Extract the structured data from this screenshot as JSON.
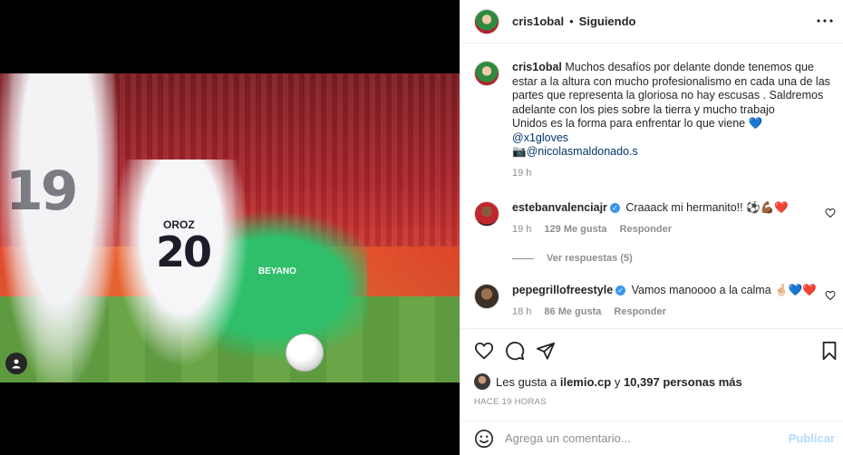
{
  "post": {
    "author": "cris1obal",
    "separator": "•",
    "follow_status": "Siguiendo",
    "caption_text": "Muchos desafíos por delante donde tenemos que estar a la altura con mucho profesionalismo en cada una de las partes que representa la gloriosa no hay escusas . Saldremos adelante con los pies sobre la tierra y mucho trabajo",
    "caption_line2": "Unidos es la forma para enfrentar lo que viene 💙",
    "mention1": "@x1gloves",
    "photo_credit_prefix": "📷",
    "mention2": "@nicolasmaldonado.s",
    "caption_time": "19 h"
  },
  "photo": {
    "shirt_name": "OROZ",
    "shirt_number": "20",
    "background_number": "19",
    "sponsor": "BEYANO"
  },
  "comments": [
    {
      "user": "estebanvalenciajr",
      "text": "Craaack mi hermanito!! ⚽💪🏾❤️",
      "time": "19 h",
      "likes": "129 Me gusta",
      "reply": "Responder",
      "view_replies": "Ver respuestas (5)"
    },
    {
      "user": "pepegrillofreestyle",
      "text": "Vamos manoooo a la calma 🤞🏻💙❤️",
      "time": "18 h",
      "likes": "86 Me gusta",
      "reply": "Responder"
    }
  ],
  "likes_summary": {
    "prefix": "Les gusta a",
    "user": "ilemio.cp",
    "connector": "y",
    "others": "10,397 personas más"
  },
  "timestamp": "HACE 19 HORAS",
  "comment_box": {
    "placeholder": "Agrega un comentario...",
    "publish_label": "Publicar"
  },
  "colors": {
    "link": "#00376b",
    "verified": "#3897f0",
    "muted": "#8e8e8e",
    "publish_disabled": "#b3dbff"
  }
}
